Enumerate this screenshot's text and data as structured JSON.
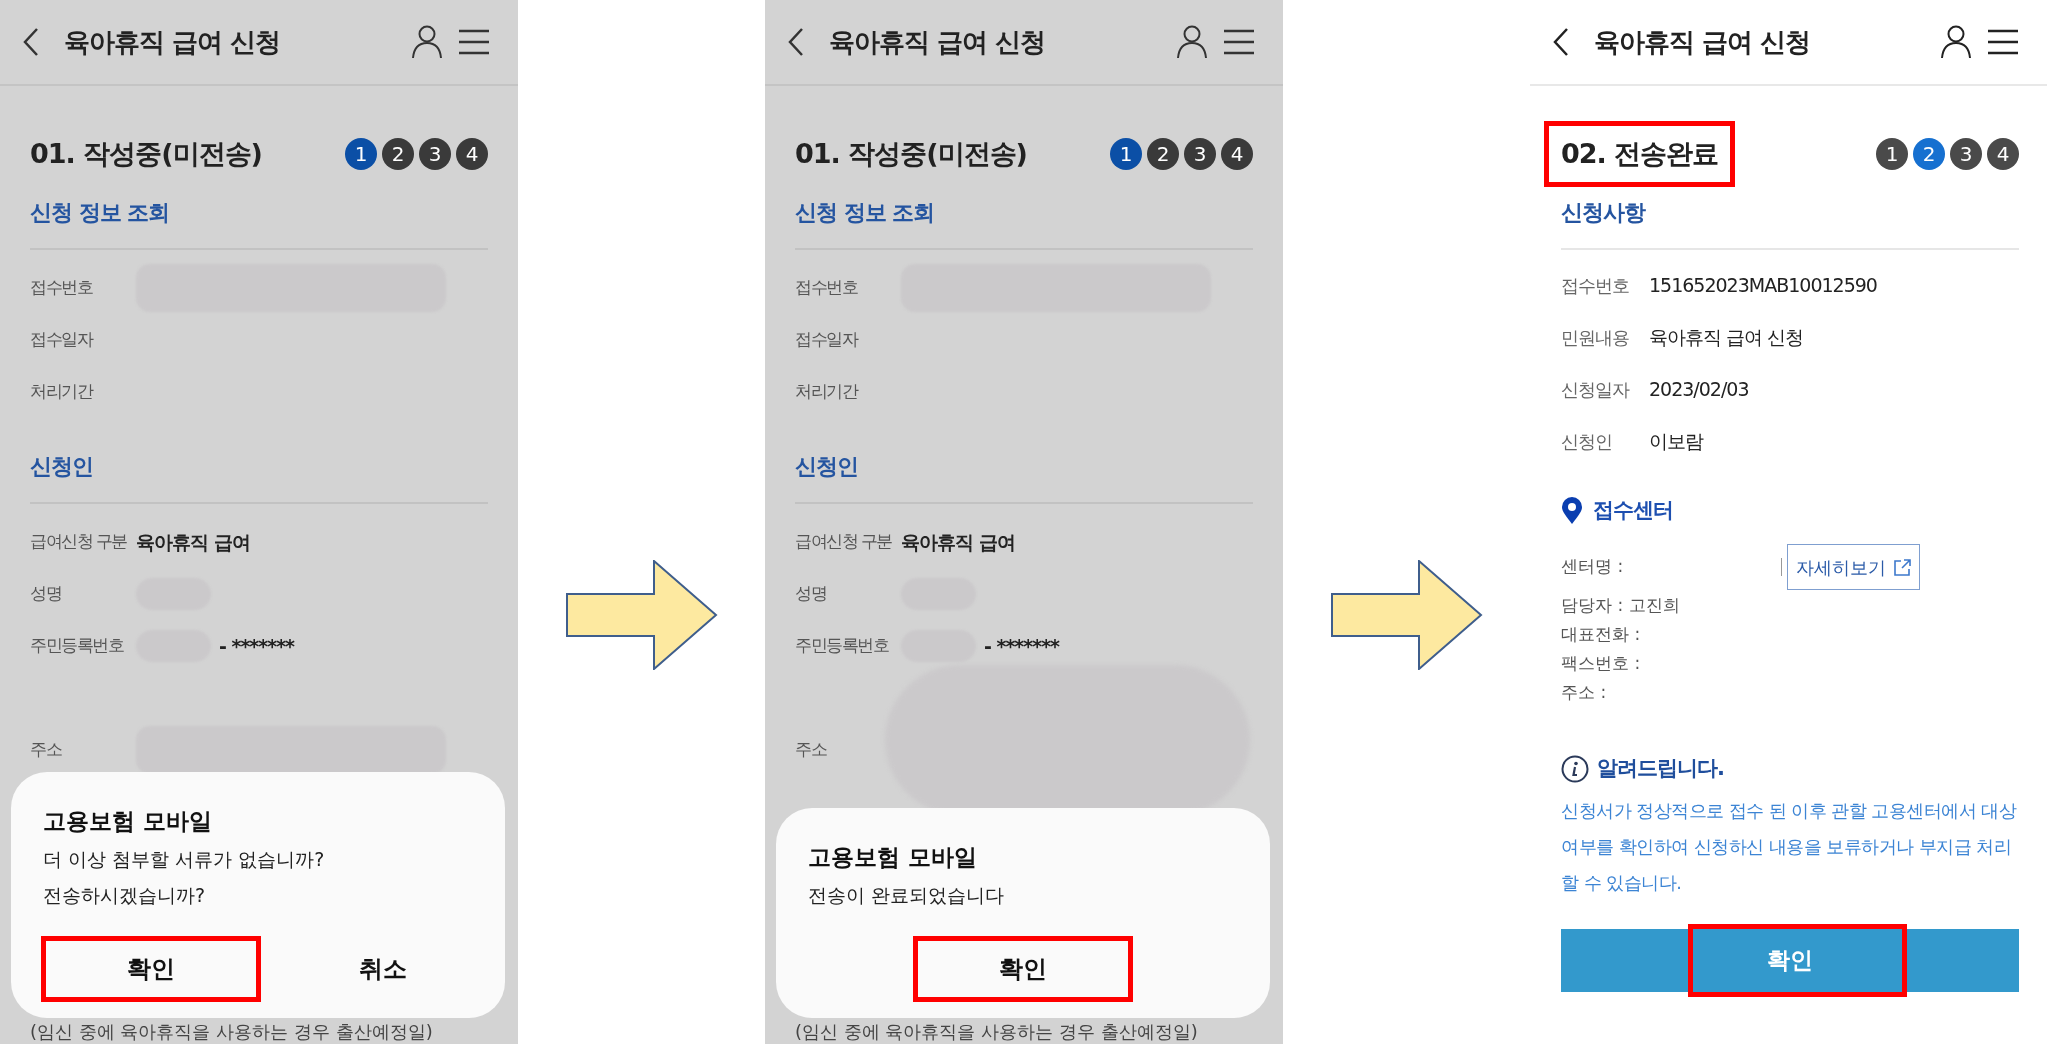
{
  "panels": [
    {
      "kind": "form",
      "dimmed": true,
      "header": {
        "title": "육아휴직 급여 신청"
      },
      "status": {
        "title": "01. 작성중(미전송)",
        "highlighted": false
      },
      "steps": [
        {
          "label": "1",
          "selected": true
        },
        {
          "label": "2",
          "selected": false
        },
        {
          "label": "3",
          "selected": false
        },
        {
          "label": "4",
          "selected": false
        }
      ],
      "sections": [
        {
          "heading": "신청 정보 조회",
          "rows": [
            {
              "label": "접수번호",
              "redacted": true
            },
            {
              "label": "접수일자"
            },
            {
              "label": "처리기간"
            }
          ]
        },
        {
          "heading": "신청인",
          "rows": [
            {
              "label": "급여신청 구분",
              "value": "육아휴직 급여"
            },
            {
              "label": "성명",
              "redacted": true
            },
            {
              "label": "주민등록번호",
              "redacted": true,
              "value": "- *******"
            },
            {
              "label": "주소",
              "redacted": true
            }
          ]
        }
      ],
      "footnote": "(임신 중에 육아휴직을 사용하는 경우 출산예정일)",
      "dialog": {
        "title": "고용보험 모바일",
        "message": [
          "더 이상 첨부할 서류가 없습니까?",
          "전송하시겠습니까?"
        ],
        "buttons": [
          {
            "label": "확인",
            "highlighted": true
          },
          {
            "label": "취소",
            "highlighted": false
          }
        ]
      }
    },
    {
      "kind": "form",
      "dimmed": true,
      "header": {
        "title": "육아휴직 급여 신청"
      },
      "status": {
        "title": "01. 작성중(미전송)",
        "highlighted": false
      },
      "steps": [
        {
          "label": "1",
          "selected": true
        },
        {
          "label": "2",
          "selected": false
        },
        {
          "label": "3",
          "selected": false
        },
        {
          "label": "4",
          "selected": false
        }
      ],
      "redaction_cloud": true,
      "sections": [
        {
          "heading": "신청 정보 조회",
          "rows": [
            {
              "label": "접수번호",
              "redacted": true
            },
            {
              "label": "접수일자"
            },
            {
              "label": "처리기간"
            }
          ]
        },
        {
          "heading": "신청인",
          "rows": [
            {
              "label": "급여신청 구분",
              "value": "육아휴직 급여"
            },
            {
              "label": "성명",
              "redacted": true
            },
            {
              "label": "주민등록번호",
              "redacted": true,
              "value": "- *******"
            },
            {
              "label": "주소"
            }
          ]
        }
      ],
      "footnote": "(임신 중에 육아휴직을 사용하는 경우 출산예정일)",
      "dialog": {
        "title": "고용보험 모바일",
        "message": [
          "전송이 완료되었습니다"
        ],
        "buttons": [
          {
            "label": "확인",
            "highlighted": true
          }
        ]
      }
    },
    {
      "kind": "result",
      "dimmed": false,
      "header": {
        "title": "육아휴직 급여 신청"
      },
      "status": {
        "title": "02. 전송완료",
        "highlighted": true
      },
      "steps": [
        {
          "label": "1",
          "selected": false
        },
        {
          "label": "2",
          "selected": true
        },
        {
          "label": "3",
          "selected": false
        },
        {
          "label": "4",
          "selected": false
        }
      ],
      "sections": [
        {
          "heading": "신청사항",
          "rows": [
            {
              "label": "접수번호",
              "value": "151652023MAB10012590"
            },
            {
              "label": "민원내용",
              "value": "육아휴직 급여 신청"
            },
            {
              "label": "신청일자",
              "value": "2023/02/03"
            },
            {
              "label": "신청인",
              "value": "이보람"
            }
          ]
        }
      ],
      "center": {
        "heading": "접수센터",
        "lines": [
          "센터명 :",
          "담당자 : 고진희",
          "대표전화 :",
          "팩스번호 :",
          "주소 :"
        ],
        "detail_link": "자세히보기"
      },
      "notice": {
        "heading": "알려드립니다.",
        "text": "신청서가 정상적으로 접수 된 이후 관할 고용센터에서 대상여부를 확인하여 신청하신 내용을 보류하거나 부지급 처리 할 수 있습니다."
      },
      "confirm": {
        "label": "확인",
        "highlighted": true
      }
    }
  ]
}
